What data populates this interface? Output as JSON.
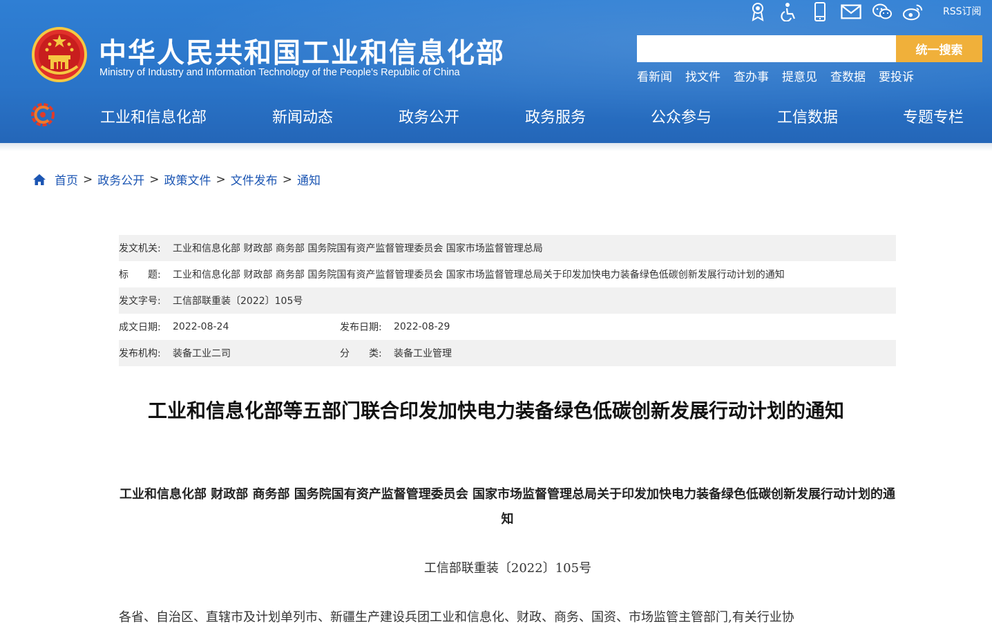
{
  "header": {
    "title": "中华人民共和国工业和信息化部",
    "subtitle": "Ministry of Industry and Information Technology of the People's Republic of China",
    "rss_label": "RSS订阅",
    "search": {
      "placeholder": "",
      "button_label": "统一搜索"
    },
    "quick_links": [
      "看新闻",
      "找文件",
      "查办事",
      "提意见",
      "查数据",
      "要投诉"
    ],
    "util_icons": [
      "elder-care-icon",
      "accessibility-icon",
      "mobile-icon",
      "mail-icon",
      "wechat-icon",
      "weibo-icon"
    ]
  },
  "nav": {
    "items": [
      "工业和信息化部",
      "新闻动态",
      "政务公开",
      "政务服务",
      "公众参与",
      "工信数据",
      "专题专栏"
    ]
  },
  "breadcrumb": {
    "items": [
      "首页",
      "政务公开",
      "政策文件",
      "文件发布",
      "通知"
    ],
    "separator": ">"
  },
  "meta": {
    "issuer_label": "发文机关:",
    "issuer_value": "工业和信息化部 财政部 商务部 国务院国有资产监督管理委员会 国家市场监督管理总局",
    "title_label": "标　　题:",
    "title_value": "工业和信息化部 财政部 商务部 国务院国有资产监督管理委员会 国家市场监督管理总局关于印发加快电力装备绿色低碳创新发展行动计划的通知",
    "docno_label": "发文字号:",
    "docno_value": "工信部联重装〔2022〕105号",
    "created_label": "成文日期:",
    "created_value": "2022-08-24",
    "published_label": "发布日期:",
    "published_value": "2022-08-29",
    "org_label": "发布机构:",
    "org_value": "装备工业二司",
    "category_label": "分　　类:",
    "category_value": "装备工业管理"
  },
  "article": {
    "title": "工业和信息化部等五部门联合印发加快电力装备绿色低碳创新发展行动计划的通知",
    "subtitle": "工业和信息化部  财政部  商务部  国务院国有资产监督管理委员会  国家市场监督管理总局关于印发加快电力装备绿色低碳创新发展行动计划的通知",
    "doc_number": "工信部联重装〔2022〕105号",
    "first_paragraph": "各省、自治区、直辖市及计划单列市、新疆生产建设兵团工业和信息化、财政、商务、国资、市场监管主管部门,有关行业协"
  },
  "colors": {
    "header_blue": "#2a74c8",
    "search_button": "#f0b03a",
    "link_blue": "#1c56b3",
    "meta_shade": "#f1f1f1"
  }
}
